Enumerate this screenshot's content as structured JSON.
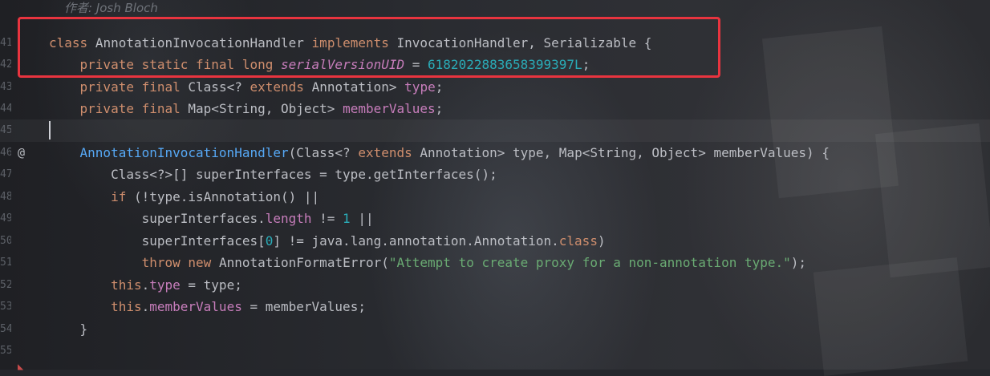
{
  "editor": {
    "author_hint": "作者: Josh Bloch",
    "line_numbers": [
      "41",
      "42",
      "43",
      "44",
      "45",
      "46",
      "47",
      "48",
      "49",
      "50",
      "51",
      "52",
      "53",
      "54",
      "55"
    ],
    "override_marker": "@",
    "lines": {
      "l1": {
        "kw_class": "class",
        "name": "AnnotationInvocationHandler",
        "kw_implements": "implements",
        "rest": "InvocationHandler, Serializable {"
      },
      "l2": {
        "kw": "private static final long",
        "field": "serialVersionUID",
        "eq": " = ",
        "value": "6182022883658399397L",
        "end": ";"
      },
      "l3": {
        "kw": "private final",
        "type_a": "Class<?",
        "kw_extends": "extends",
        "type_b": "Annotation>",
        "field": "type",
        "end": ";"
      },
      "l4": {
        "kw": "private final",
        "type": "Map<String, Object>",
        "field": "memberValues",
        "end": ";"
      },
      "l6": {
        "ctor": "AnnotationInvocationHandler",
        "open": "(Class<?",
        "kw_extends": "extends",
        "rest": "Annotation> type, Map<String, Object> memberValues) {"
      },
      "l7": {
        "text": "Class<?>[] superInterfaces = type.getInterfaces();"
      },
      "l8": {
        "kw_if": "if",
        "rest": "(!type.isAnnotation() ||"
      },
      "l9": {
        "pre": "superInterfaces.",
        "field": "length",
        "op": " != ",
        "num": "1",
        "post": " ||"
      },
      "l10": {
        "pre": "superInterfaces[",
        "num": "0",
        "mid": "] != java.lang.annotation.Annotation.",
        "kw_class": "class",
        "post": ")"
      },
      "l11": {
        "kw_throw": "throw",
        "kw_new": "new",
        "ctor": "AnnotationFormatError(",
        "str": "\"Attempt to create proxy for a non-annotation type.\"",
        "post": ");"
      },
      "l12": {
        "kw_this": "this",
        "dot": ".",
        "field": "type",
        "post": " = type;"
      },
      "l13": {
        "kw_this": "this",
        "dot": ".",
        "field": "memberValues",
        "post": " = memberValues;"
      },
      "l14": {
        "text": "}"
      }
    }
  },
  "colors": {
    "keyword": "#cf8e6d",
    "function": "#56a8f5",
    "field": "#c77dbb",
    "number": "#2aacb8",
    "string": "#6aab73",
    "default": "#bcbec4",
    "highlight_box": "#e8343f"
  }
}
